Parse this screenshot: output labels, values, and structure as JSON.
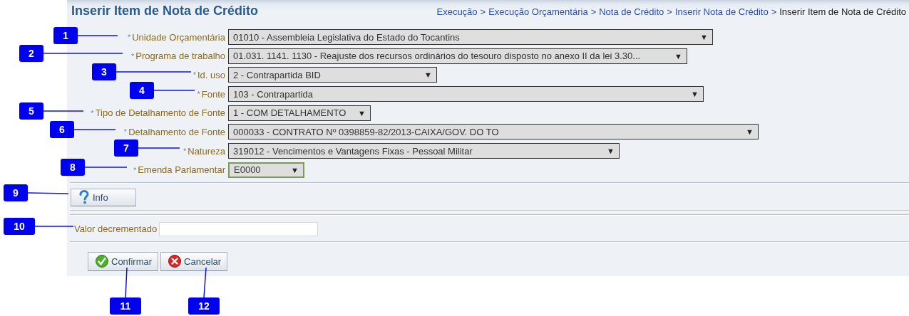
{
  "title": "Inserir Item de Nota de Crédito",
  "breadcrumb": {
    "separator": ">",
    "items": [
      {
        "label": "Execução",
        "current": false
      },
      {
        "label": "Execução Orçamentária",
        "current": false
      },
      {
        "label": "Nota de Crédito",
        "current": false
      },
      {
        "label": "Inserir Nota de Crédito",
        "current": false
      },
      {
        "label": "Inserir Item de Nota de Crédito",
        "current": true
      }
    ]
  },
  "fields": [
    {
      "marker": "*",
      "label": "Unidade Orçamentária",
      "value": "01010 - Assembleia Legislativa do Estado do Tocantins",
      "focused": false
    },
    {
      "marker": "*",
      "label": "Programa de trabalho",
      "value": "01.031. 1141. 1130 - Reajuste dos recursos ordinários do tesouro disposto no anexo II da lei 3.30...",
      "focused": false
    },
    {
      "marker": "*",
      "label": "Id. uso",
      "value": "2 - Contrapartida BID",
      "focused": false
    },
    {
      "marker": "*",
      "label": "Fonte",
      "value": "103 - Contrapartida",
      "focused": false
    },
    {
      "marker": "*",
      "label": "Tipo de Detalhamento de Fonte",
      "value": "1 - COM DETALHAMENTO",
      "focused": false
    },
    {
      "marker": "*",
      "label": "Detalhamento de Fonte",
      "value": "000033 - CONTRATO Nº 0398859-82/2013-CAIXA/GOV. DO TO",
      "focused": false
    },
    {
      "marker": "*",
      "label": "Natureza",
      "value": "319012 - Vencimentos e Vantagens Fixas - Pessoal Militar",
      "focused": false
    },
    {
      "marker": "*",
      "label": "Emenda Parlamentar",
      "value": "E0000",
      "focused": true
    }
  ],
  "dropdown_arrow": "▼",
  "info_button": "Info",
  "amount_field": {
    "label": "Valor decrementado"
  },
  "actions": [
    {
      "kind": "confirm",
      "label": "Confirmar"
    },
    {
      "kind": "cancel",
      "label": "Cancelar"
    }
  ],
  "annotations": [
    "1",
    "2",
    "3",
    "4",
    "5",
    "6",
    "7",
    "8",
    "9",
    "10",
    "11",
    "12"
  ]
}
